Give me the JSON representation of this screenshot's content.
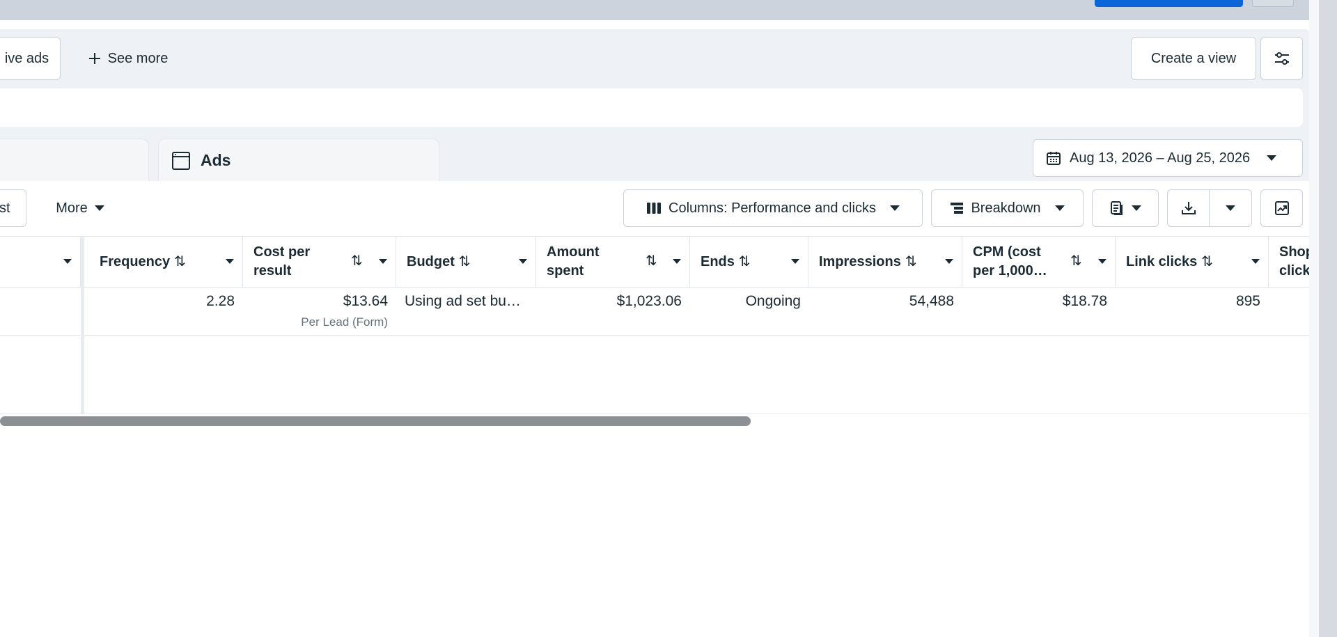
{
  "tabs_row": {
    "creative_ads_fragment": "ive ads",
    "see_more_label": "See more",
    "create_view_label": "Create a view"
  },
  "level_tabs": {
    "ads_label": "Ads"
  },
  "date_range": {
    "label": "Aug 13, 2026 – Aug 25, 2026"
  },
  "toolbar": {
    "left_fragment": "st",
    "more_label": "More",
    "columns_label": "Columns: Performance and clicks",
    "breakdown_label": "Breakdown"
  },
  "table": {
    "columns": [
      {
        "id": "frequency",
        "label": "Frequency"
      },
      {
        "id": "cost_per_result",
        "label": "Cost per result"
      },
      {
        "id": "budget",
        "label": "Budget"
      },
      {
        "id": "amount_spent",
        "label": "Amount spent"
      },
      {
        "id": "ends",
        "label": "Ends"
      },
      {
        "id": "impressions",
        "label": "Impressions"
      },
      {
        "id": "cpm",
        "label": "CPM (cost per 1,000…"
      },
      {
        "id": "link_clicks",
        "label": "Link clicks"
      },
      {
        "id": "shop_clicks",
        "label": "Shop click"
      }
    ],
    "rows": [
      {
        "frequency": "2.28",
        "cost_per_result": "$13.64",
        "cost_per_result_sub": "Per Lead (Form)",
        "budget": "Using ad set bu…",
        "amount_spent": "$1,023.06",
        "ends": "Ongoing",
        "impressions": "54,488",
        "cpm": "$18.78",
        "link_clicks": "895"
      }
    ]
  },
  "icons": {
    "see_more": "plus-icon",
    "view_settings": "sliders-icon",
    "ads_tab": "ad-frame-icon",
    "date": "calendar-icon",
    "columns": "columns-icon",
    "breakdown": "breakdown-icon",
    "reports": "reports-icon",
    "export": "download-icon",
    "charts": "chart-icon"
  },
  "colors": {
    "primary_blue": "#0a66d8",
    "text": "#1c2b33",
    "muted_text": "#65737e",
    "panel_gray": "#eef1f5"
  }
}
